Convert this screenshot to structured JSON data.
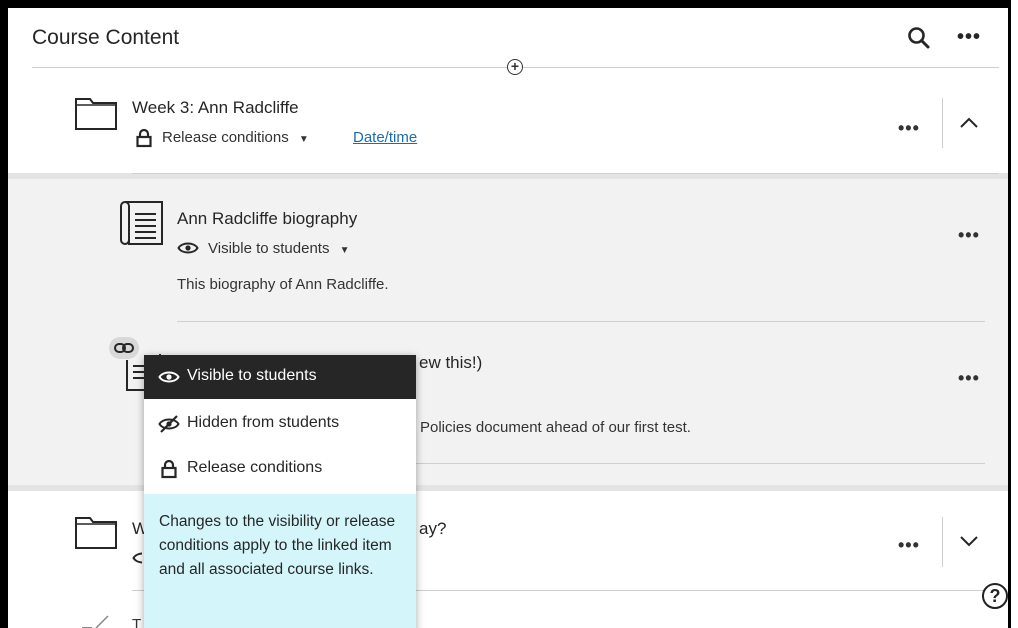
{
  "header": {
    "title": "Course Content",
    "search_icon": "search-icon",
    "more_icon": "ellipsis-icon",
    "more_label": "•••"
  },
  "add_icon_label": "+",
  "folder_week3": {
    "title": "Week 3: Ann Radcliffe",
    "release_label": "Release conditions",
    "date_link": "Date/time",
    "more_label": "•••",
    "icon": "folder-icon"
  },
  "items": [
    {
      "title": "Ann Radcliffe biography",
      "visibility": "Visible to students",
      "description": "This biography of Ann Radcliffe.",
      "more_label": "•••",
      "icon": "document-icon"
    },
    {
      "title_visible_part": "ew this!)",
      "description_visible_part": "Policies document ahead of our first test.",
      "more_label": "•••",
      "icon": "document-icon"
    }
  ],
  "folder_next": {
    "title_start": "W",
    "title_end": "ay?",
    "more_label": "•••",
    "icon": "folder-icon"
  },
  "bottom_partial": "T",
  "visibility_menu": {
    "options": [
      {
        "label": "Visible to students",
        "icon": "eye-icon",
        "selected": true
      },
      {
        "label": "Hidden from students",
        "icon": "eye-slash-icon",
        "selected": false
      },
      {
        "label": "Release conditions",
        "icon": "lock-icon",
        "selected": false
      }
    ],
    "note": "Changes to the visibility or release conditions apply to the linked item and all associated course links."
  },
  "help_label": "?",
  "colors": {
    "link": "#1c6ea7",
    "menu_selected_bg": "#262626",
    "note_bg": "#d4f6fb",
    "section_bg": "#f2f2f2"
  }
}
